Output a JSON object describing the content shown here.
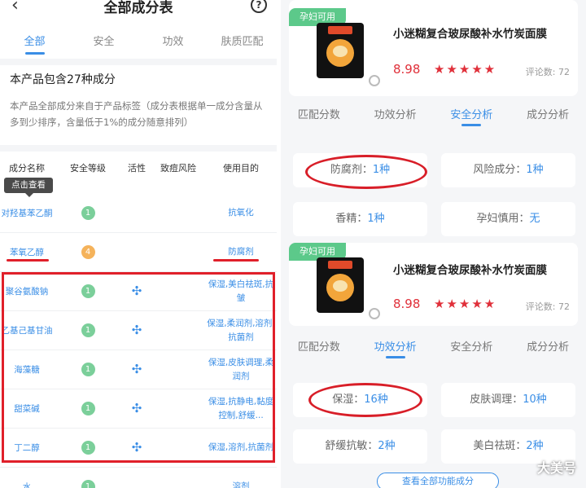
{
  "left": {
    "title": "全部成分表",
    "back_icon": "‹",
    "help_icon": "?",
    "tabs": [
      {
        "label": "全部",
        "active": true
      },
      {
        "label": "安全"
      },
      {
        "label": "功效"
      },
      {
        "label": "肤质匹配"
      }
    ],
    "count_title": "本产品包含27种成分",
    "note": "本产品全部成分来自于产品标签（成分表根据单一成分含量从多到少排序，含量低于1%的成分随意排列）",
    "headers": [
      "成分名称",
      "安全等级",
      "活性",
      "致痘风险",
      "使用目的"
    ],
    "tooltip": "点击查看",
    "rows": [
      {
        "name": "对羟基苯乙酮",
        "level": "1",
        "active": false,
        "purpose": "抗氧化"
      },
      {
        "name": "苯氧乙醇",
        "level": "4",
        "active": false,
        "purpose": "防腐剂"
      },
      {
        "name": "聚谷氨酸钠",
        "level": "1",
        "active": true,
        "purpose": "保湿,美白祛斑,抗皱"
      },
      {
        "name": "乙基己基甘油",
        "level": "1",
        "active": true,
        "purpose": "保湿,柔润剂,溶剂,抗菌剂"
      },
      {
        "name": "海藻糖",
        "level": "1",
        "active": true,
        "purpose": "保湿,皮肤调理,柔润剂"
      },
      {
        "name": "甜菜碱",
        "level": "1",
        "active": true,
        "purpose": "保湿,抗静电,黏度控制,舒缓..."
      },
      {
        "name": "丁二醇",
        "level": "1",
        "active": true,
        "purpose": "保湿,溶剂,抗菌剂"
      },
      {
        "name": "水",
        "level": "1",
        "active": false,
        "purpose": "溶剂"
      }
    ]
  },
  "right": {
    "badge": "孕妇可用",
    "product_name": "小迷糊复合玻尿酸补水竹炭面膜",
    "stars": "★★★★★",
    "stars_value": 4.5,
    "panel1": {
      "price": "8.98",
      "reviews": "评论数: 72",
      "tabs": [
        {
          "label": "匹配分数"
        },
        {
          "label": "功效分析"
        },
        {
          "label": "安全分析",
          "active": true
        },
        {
          "label": "成分分析"
        }
      ],
      "pills": [
        {
          "label": "防腐剂：",
          "value": "1种"
        },
        {
          "label": "风险成分：",
          "value": "1种"
        },
        {
          "label": "香精：",
          "value": "1种"
        },
        {
          "label": "孕妇慎用：",
          "value": "无"
        }
      ]
    },
    "panel2": {
      "price": "8.98",
      "reviews": "评论数: 72",
      "tabs": [
        {
          "label": "匹配分数"
        },
        {
          "label": "功效分析",
          "active": true
        },
        {
          "label": "安全分析"
        },
        {
          "label": "成分分析"
        }
      ],
      "pills": [
        {
          "label": "保湿：",
          "value": "16种"
        },
        {
          "label": "皮肤调理：",
          "value": "10种"
        },
        {
          "label": "舒缓抗敏：",
          "value": "2种"
        },
        {
          "label": "美白祛斑：",
          "value": "2种"
        }
      ],
      "more_button": "查看全部功能成分"
    },
    "watermark": "大美号"
  },
  "colors": {
    "accent": "#3a8ee6",
    "highlight": "#e0202a",
    "badge": "#5cc98a",
    "price": "#e0303a"
  }
}
